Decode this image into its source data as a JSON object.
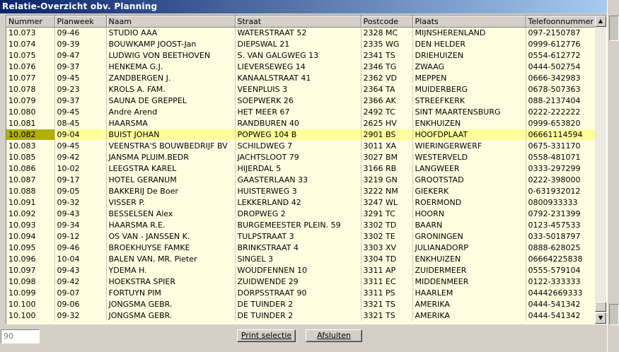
{
  "window": {
    "title": "Relatie-Overzicht obv. Planning"
  },
  "columns": [
    "Nummer",
    "Planweek",
    "Naam",
    "Straat",
    "Postcode",
    "Plaats",
    "Telefoonnummer"
  ],
  "rows": [
    [
      "10.073",
      "09-46",
      "STUDIO AAA",
      "WATERSTRAAT 52",
      "2328 MC",
      "MIJNSHERENLAND",
      "097-2150787"
    ],
    [
      "10.074",
      "09-39",
      "BOUWKAMP JOOST-Jan",
      "DIEPSWAL 21",
      "2335 WG",
      "DEN HELDER",
      "0999-612776"
    ],
    [
      "10.075",
      "09-47",
      "LUDWIG VON BEETHOVEN",
      "S. VAN GALGWEG 13",
      "2341 TS",
      "DRIEHUIZEN",
      "0554-612772"
    ],
    [
      "10.076",
      "09-37",
      "HENKEMA G.J.",
      "LIEVERSEWEG 14",
      "2346 TG",
      "ZWAAG",
      "0444-502754"
    ],
    [
      "10.077",
      "09-45",
      "ZANDBERGEN J.",
      "KANAALSTRAAT 41",
      "2362 VD",
      "MEPPEN",
      "0666-342983"
    ],
    [
      "10.078",
      "09-23",
      "KROLS  A. FAM.",
      "VEENPLUIS 3",
      "2364 TA",
      "MUIDERBERG",
      "0678-507363"
    ],
    [
      "10.079",
      "09-37",
      "SAUNA DE GREPPEL",
      "SOEPWERK 26",
      "2366 AK",
      "STREEFKERK",
      "088-2137404"
    ],
    [
      "10.080",
      "09-45",
      "Andre Arend",
      "HET MEER 67",
      "2492 TC",
      "SINT MAARTENSBURG",
      "0222-222222"
    ],
    [
      "10.081",
      "08-45",
      "HAARSMA",
      "RANDBUREN 40",
      "2625 HV",
      "ENKHUIZEN",
      "0999-653820"
    ],
    [
      "10.082",
      "09-04",
      "BUIST JOHAN",
      "POPWEG 104 B",
      "2901 BS",
      "HOOFDPLAAT",
      "06661114594"
    ],
    [
      "10.083",
      "09-45",
      "VEENSTRA'S BOUWBEDRIJF BV",
      "SCHILDWEG 7",
      "3011 XA",
      "WIERINGERWERF",
      "0675-331170"
    ],
    [
      "10.085",
      "09-42",
      "JANSMA PLUIM.BEDR",
      "JACHTSLOOT 79",
      "3027 BM",
      "WESTERVELD",
      "0558-481071"
    ],
    [
      "10.086",
      "10-02",
      "LEEGSTRA KAREL",
      "HIJERDAL 5",
      "3166 RB",
      "LANGWEER",
      "0333-297299"
    ],
    [
      "10.087",
      "09-17",
      "HOTEL GERANUM",
      "GAASTERLAAN 33",
      "3219 GN",
      "GROOTSTAD",
      "0222-398000"
    ],
    [
      "10.088",
      "09-05",
      "BAKKERIJ De Boer",
      "HUISTERWEG 3",
      "3222 NM",
      "GIEKERK",
      "0-631932012"
    ],
    [
      "10.091",
      "09-32",
      "VISSER P.",
      "LEKKERLAND 42",
      "3247 WL",
      "ROERMOND",
      "0800933333"
    ],
    [
      "10.092",
      "09-43",
      "BESSELSEN Alex",
      "DROPWEG 2",
      "3291 TC",
      "HOORN",
      "0792-231399"
    ],
    [
      "10.093",
      "09-34",
      "HAARSMA R.E.",
      "BURGEMEESTER PLEIN. 59",
      "3302 TD",
      "BAARN",
      "0123-457533"
    ],
    [
      "10.094",
      "09-12",
      "OS VAN - JANSSEN K.",
      "TULPSTRAAT 3",
      "3302 TE",
      "GRONINGEN",
      "033-5018797"
    ],
    [
      "10.095",
      "09-46",
      "BROEKHUYSE FAMKE",
      "BRINKSTRAAT 4",
      "3303 XV",
      "JULIANADORP",
      "0888-628025"
    ],
    [
      "10.096",
      "10-04",
      "BALEN VAN, MR. Pieter",
      "SINGEL 3",
      "3304 TD",
      "ENKHUIZEN",
      "06664225838"
    ],
    [
      "10.097",
      "09-43",
      "YDEMA H.",
      "WOUDFENNEN 10",
      "3311 AP",
      "ZUIDERMEER",
      "0555-579104"
    ],
    [
      "10.098",
      "09-42",
      "HOEKSTRA SPIER",
      "ZUIDWENDE 29",
      "3311 EC",
      "MIDDENMEER",
      "0122-333333"
    ],
    [
      "10.099",
      "09-07",
      "FORTUYN PIM",
      "DORPSSTRAAT 90",
      "3311 PS",
      "HAARLEM",
      "04442669333"
    ],
    [
      "10.100",
      "09-06",
      "JONGSMA GEBR.",
      "DE TUINDER 2",
      "3321 TS",
      "AMERIKA",
      "0444-541342"
    ],
    [
      "10.100",
      "09-32",
      "JONGSMA GEBR.",
      "DE TUINDER 2",
      "3321 TS",
      "AMERIKA",
      "0444-541342"
    ]
  ],
  "selected_row": 9,
  "colors": {
    "row_bg": "#fffee0",
    "selected_bg": "#ffff99",
    "selected_marker": "#b0b000",
    "titlebar_start": "#0a246a"
  },
  "footer": {
    "count": "90",
    "print_label": "Print selectie",
    "close_label": "Afsluiten"
  },
  "icons": {
    "scroll_up": "triangle-up-icon",
    "scroll_down": "triangle-down-icon"
  }
}
